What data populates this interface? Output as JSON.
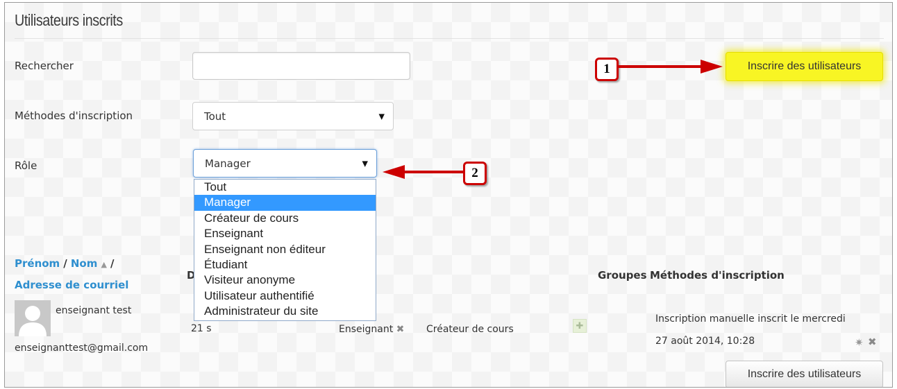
{
  "title": "Utilisateurs inscrits",
  "filters": {
    "search_label": "Rechercher",
    "search_value": "",
    "methods_label": "Méthodes d'inscription",
    "methods_value": "Tout",
    "role_label": "Rôle",
    "role_value": "Manager"
  },
  "role_options": [
    "Tout",
    "Manager",
    "Créateur de cours",
    "Enseignant",
    "Enseignant non éditeur",
    "Étudiant",
    "Visiteur anonyme",
    "Utilisateur authentifié",
    "Administrateur du site"
  ],
  "role_selected_index": 1,
  "enrol_button_label": "Inscrire des utilisateurs",
  "annotations": {
    "badge1": "1",
    "badge2": "2"
  },
  "table": {
    "col_firstname": "Prénom",
    "sep": "/",
    "col_lastname": "Nom",
    "sort_icon": "▲",
    "sep2": "/",
    "col_email": "Adresse de courriel",
    "col_d_partial": "D",
    "col_groups": "Groupes",
    "col_methods": "Méthodes d'inscription"
  },
  "row": {
    "name": "enseignant test",
    "email": "enseignanttest@gmail.com",
    "last_access": "21 s",
    "role1": "Enseignant",
    "role2": "Créateur de cours",
    "method_line1": "Inscription manuelle inscrit le mercredi",
    "method_line2": "27 août 2014, 10:28"
  },
  "colors": {
    "accent_link": "#2f8fcf",
    "highlight": "#f8f524",
    "arrow": "#cc0000",
    "selected": "#3399ff"
  }
}
